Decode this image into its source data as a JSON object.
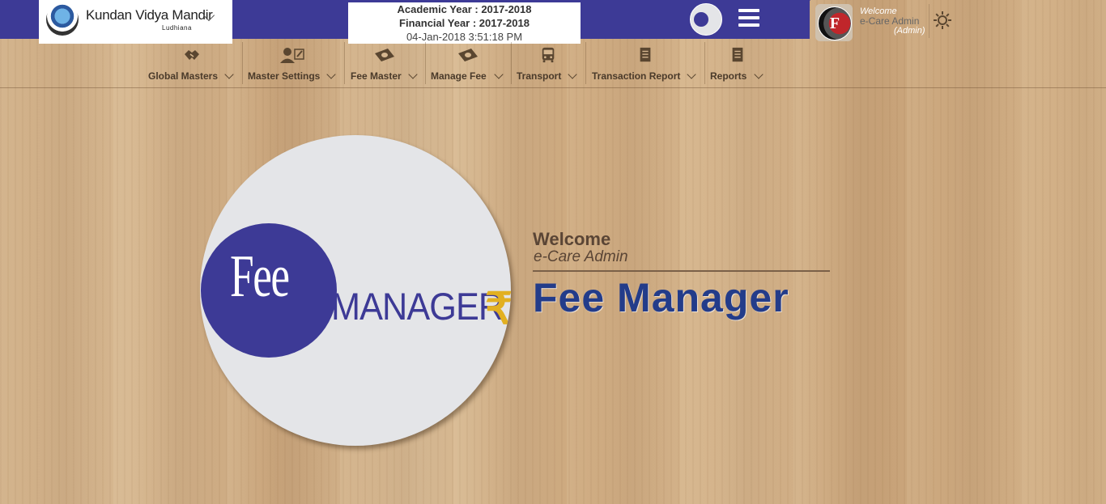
{
  "header": {
    "school_name": "Kundan Vidya Mandir",
    "school_city": "Ludhiana",
    "academic_year": "Academic Year : 2017-2018",
    "financial_year": "Financial Year : 2017-2018",
    "datetime": "04-Jan-2018 3:51:18 PM",
    "brand_color": "#3d3a96"
  },
  "user": {
    "welcome": "Welcome",
    "name": "e-Care Admin",
    "role": "(Admin)",
    "avatar_letter": "F"
  },
  "nav": {
    "items": [
      {
        "label": "Global Masters",
        "icon": "handshake-icon"
      },
      {
        "label": "Master Settings",
        "icon": "user-edit-icon"
      },
      {
        "label": "Fee Master",
        "icon": "money-icon"
      },
      {
        "label": "Manage Fee",
        "icon": "money-icon"
      },
      {
        "label": "Transport",
        "icon": "bus-icon"
      },
      {
        "label": "Transaction Report",
        "icon": "report-icon"
      },
      {
        "label": "Reports",
        "icon": "report-icon"
      }
    ]
  },
  "main": {
    "logo_fee": "Fee",
    "logo_manager": "MANAGER",
    "logo_rupee": "₹",
    "welcome": "Welcome",
    "user": "e-Care Admin",
    "app_title": "Fee Manager",
    "title_color": "#233c8a",
    "accent_gold": "#e2b021"
  }
}
